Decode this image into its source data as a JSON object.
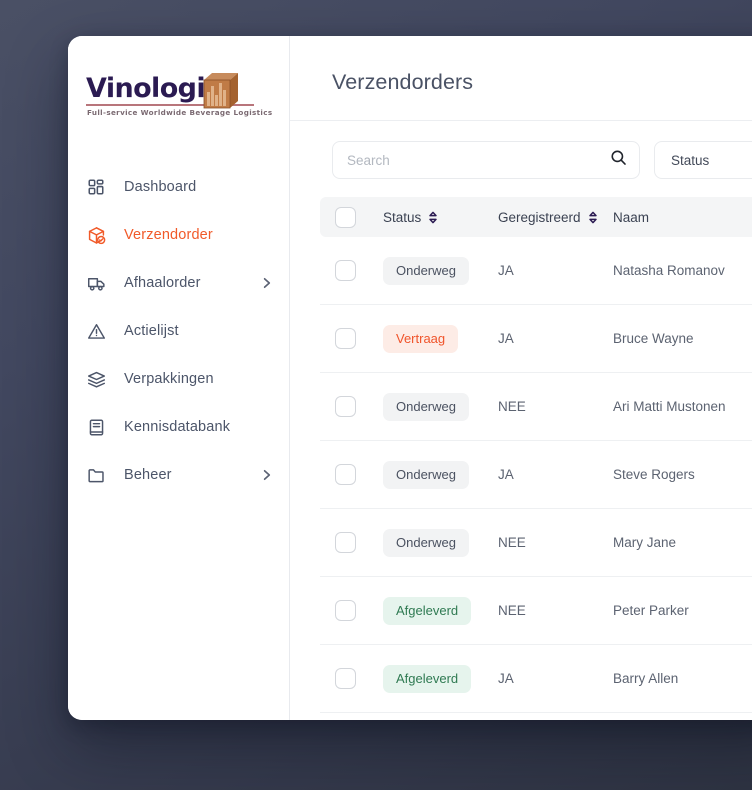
{
  "brand": {
    "name": "Vinologix",
    "tagline": "Full-service Worldwide Beverage Logistics",
    "word_color": "#2b1b52",
    "box_color": "#b8713f",
    "rule_color": "#b8757b"
  },
  "theme": {
    "accent": "#f15a29",
    "text": "#4c5569",
    "title": "#4a5265",
    "background": "#3b4153",
    "badge_neutral_bg": "#f2f3f4",
    "badge_warn_bg": "#fdece6",
    "badge_warn_fg": "#f0542b",
    "badge_ok_bg": "#e6f4ed",
    "badge_ok_fg": "#2f7a52"
  },
  "sidebar": {
    "items": [
      {
        "label": "Dashboard",
        "icon": "grid-icon",
        "active": false,
        "chevron": false
      },
      {
        "label": "Verzendorder",
        "icon": "package-check-icon",
        "active": true,
        "chevron": false
      },
      {
        "label": "Afhaalorder",
        "icon": "truck-icon",
        "active": false,
        "chevron": true
      },
      {
        "label": "Actielijst",
        "icon": "warning-icon",
        "active": false,
        "chevron": false
      },
      {
        "label": "Verpakkingen",
        "icon": "box-open-icon",
        "active": false,
        "chevron": false
      },
      {
        "label": "Kennisdatabank",
        "icon": "book-icon",
        "active": false,
        "chevron": false
      },
      {
        "label": "Beheer",
        "icon": "folder-icon",
        "active": false,
        "chevron": true
      }
    ]
  },
  "main": {
    "page_title": "Verzendorders",
    "toolbar": {
      "search_placeholder": "Search",
      "search_value": "",
      "search_icon": "search-icon",
      "status_filter_label": "Status"
    },
    "table": {
      "columns": [
        {
          "key": "check",
          "label": "",
          "sortable": false
        },
        {
          "key": "status",
          "label": "Status",
          "sortable": true
        },
        {
          "key": "reg",
          "label": "Geregistreerd",
          "sortable": true
        },
        {
          "key": "name",
          "label": "Naam",
          "sortable": false
        }
      ],
      "rows": [
        {
          "checked": false,
          "status": "Onderweg",
          "status_kind": "neutral",
          "reg": "JA",
          "name": "Natasha Romanov"
        },
        {
          "checked": false,
          "status": "Vertraag",
          "status_kind": "warn",
          "reg": "JA",
          "name": "Bruce Wayne"
        },
        {
          "checked": false,
          "status": "Onderweg",
          "status_kind": "neutral",
          "reg": "NEE",
          "name": "Ari Matti Mustonen"
        },
        {
          "checked": false,
          "status": "Onderweg",
          "status_kind": "neutral",
          "reg": "JA",
          "name": "Steve Rogers"
        },
        {
          "checked": false,
          "status": "Onderweg",
          "status_kind": "neutral",
          "reg": "NEE",
          "name": "Mary Jane"
        },
        {
          "checked": false,
          "status": "Afgeleverd",
          "status_kind": "ok",
          "reg": "NEE",
          "name": "Peter Parker"
        },
        {
          "checked": false,
          "status": "Afgeleverd",
          "status_kind": "ok",
          "reg": "JA",
          "name": "Barry Allen"
        }
      ]
    }
  }
}
